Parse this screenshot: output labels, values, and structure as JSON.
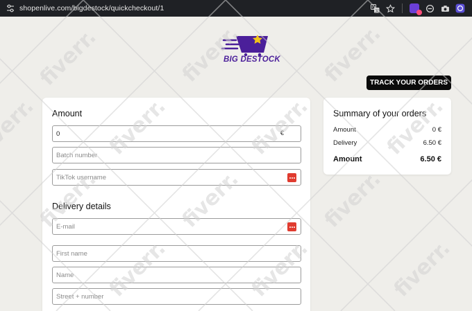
{
  "browser": {
    "url": "shopenlive.com/bigdestock/quickcheckout/1",
    "icons": [
      "tune-icon",
      "translate-icon",
      "star-icon",
      "extension-icon",
      "shield-icon",
      "camera-icon",
      "profile-icon"
    ]
  },
  "brand": {
    "logo_text": "BIG DESTOCK",
    "colors": {
      "primary": "#4b1f9a",
      "star": "#f2c31b"
    }
  },
  "header": {
    "track_button": "TRACK YOUR ORDERS"
  },
  "form": {
    "amount_title": "Amount",
    "amount_value": "0",
    "amount_currency": "€",
    "batch_placeholder": "Batch number",
    "tiktok_placeholder": "TikTok username",
    "delivery_title": "Delivery details",
    "email_placeholder": "E-mail",
    "firstname_placeholder": "First name",
    "name_placeholder": "Name",
    "street_placeholder": "Street + number"
  },
  "summary": {
    "title": "Summary of your orders",
    "rows": [
      {
        "label": "Amount",
        "value": "0 €"
      },
      {
        "label": "Delivery",
        "value": "6.50 €"
      }
    ],
    "total": {
      "label": "Amount",
      "value": "6.50 €"
    }
  },
  "watermark": {
    "text": "fiverr."
  }
}
